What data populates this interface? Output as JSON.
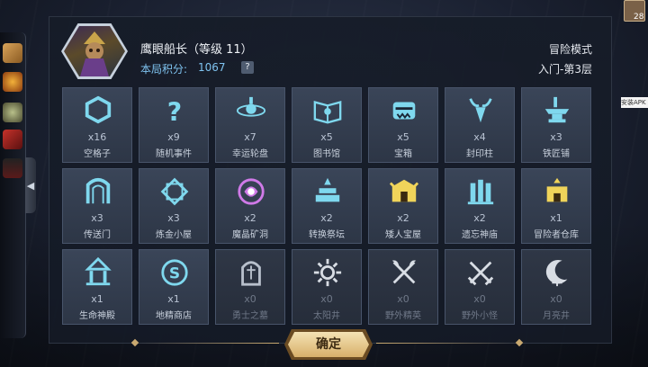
{
  "hero": {
    "name": "鹰眼船长（等级 11）",
    "score_label": "本局积分:",
    "score_value": "1067",
    "help": "?"
  },
  "mode": "冒险模式",
  "stage": "入门-第3层",
  "top_right": {
    "card_count": "28",
    "side_badge": "安装APK"
  },
  "sidebar": {
    "toggle_icon": "chevron-left-icon"
  },
  "confirm_label": "确定",
  "tiles": [
    {
      "count": "x16",
      "name": "空格子",
      "icon": "hexagon-icon",
      "color": "#7fd8ee",
      "active": true
    },
    {
      "count": "x9",
      "name": "随机事件",
      "icon": "question-icon",
      "color": "#7fd8ee",
      "active": true
    },
    {
      "count": "x7",
      "name": "幸运轮盘",
      "icon": "wheel-icon",
      "color": "#7fd8ee",
      "active": true
    },
    {
      "count": "x5",
      "name": "图书馆",
      "icon": "book-icon",
      "color": "#7fd8ee",
      "active": true
    },
    {
      "count": "x5",
      "name": "宝箱",
      "icon": "chest-icon",
      "color": "#7fd8ee",
      "active": true
    },
    {
      "count": "x4",
      "name": "封印柱",
      "icon": "seal-pillar-icon",
      "color": "#7fd8ee",
      "active": true
    },
    {
      "count": "x3",
      "name": "铁匠铺",
      "icon": "anvil-icon",
      "color": "#7fd8ee",
      "active": true
    },
    {
      "count": "x3",
      "name": "传送门",
      "icon": "portal-icon",
      "color": "#7fd8ee",
      "active": true
    },
    {
      "count": "x3",
      "name": "炼金小屋",
      "icon": "alchemy-icon",
      "color": "#7fd8ee",
      "active": true
    },
    {
      "count": "x2",
      "name": "魔晶矿洞",
      "icon": "crystal-mine-icon",
      "color": "#d07ae8",
      "active": true
    },
    {
      "count": "x2",
      "name": "转换祭坛",
      "icon": "altar-icon",
      "color": "#7fd8ee",
      "active": true
    },
    {
      "count": "x2",
      "name": "矮人宝屋",
      "icon": "dwarf-treasure-icon",
      "color": "#f0d45a",
      "active": true
    },
    {
      "count": "x2",
      "name": "遗忘神庙",
      "icon": "temple-icon",
      "color": "#7fd8ee",
      "active": true
    },
    {
      "count": "x1",
      "name": "冒险者仓库",
      "icon": "warehouse-icon",
      "color": "#f0d45a",
      "active": true
    },
    {
      "count": "x1",
      "name": "生命神殿",
      "icon": "life-shrine-icon",
      "color": "#7fd8ee",
      "active": true
    },
    {
      "count": "x1",
      "name": "地精商店",
      "icon": "goblin-shop-icon",
      "color": "#7fd8ee",
      "active": true
    },
    {
      "count": "x0",
      "name": "勇士之墓",
      "icon": "tomb-icon",
      "color": "#b8c0cc",
      "active": false
    },
    {
      "count": "x0",
      "name": "太阳井",
      "icon": "sun-well-icon",
      "color": "#d8dde4",
      "active": false
    },
    {
      "count": "x0",
      "name": "野外精英",
      "icon": "crossed-axes-icon",
      "color": "#d8dde4",
      "active": false
    },
    {
      "count": "x0",
      "name": "野外小怪",
      "icon": "crossed-swords-icon",
      "color": "#d8dde4",
      "active": false
    },
    {
      "count": "x0",
      "name": "月亮井",
      "icon": "moon-well-icon",
      "color": "#d8dde4",
      "active": false
    }
  ]
}
